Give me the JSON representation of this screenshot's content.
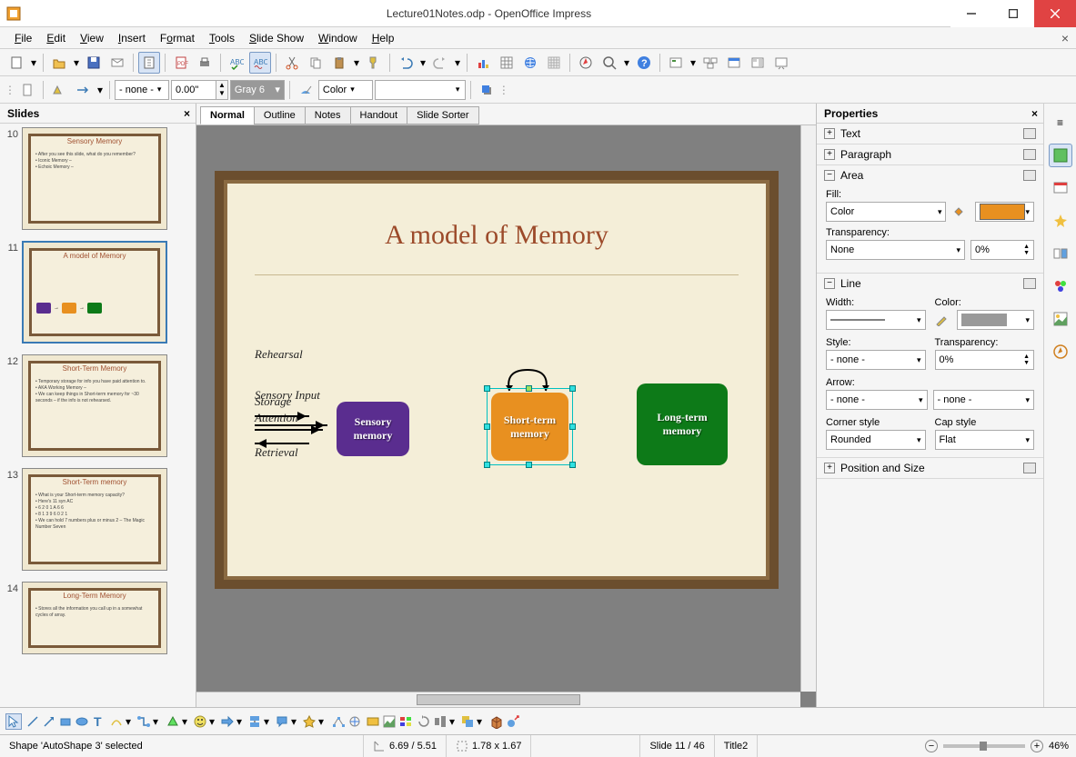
{
  "app": {
    "title": "Lecture01Notes.odp - OpenOffice Impress"
  },
  "menubar": [
    "File",
    "Edit",
    "View",
    "Insert",
    "Format",
    "Tools",
    "Slide Show",
    "Window",
    "Help"
  ],
  "toolbar2": {
    "style_combo": "- none -",
    "width_spin": "0.00\"",
    "color_combo": "Gray 6",
    "areastyle": "Color"
  },
  "viewtabs": [
    "Normal",
    "Outline",
    "Notes",
    "Handout",
    "Slide Sorter"
  ],
  "slides_panel": {
    "title": "Slides"
  },
  "thumbnails": [
    {
      "num": "10",
      "title": "Sensory Memory",
      "body": "• After you see this slide, what do you remember?\n• Iconic Memory –\n• Echoic Memory –"
    },
    {
      "num": "11",
      "title": "A model of Memory",
      "body": ""
    },
    {
      "num": "12",
      "title": "Short-Term Memory",
      "body": "• Temporary storage for info you have paid attention to.\n• AKA Working Memory –\n• We can keep things in Short-term memory for ~30 seconds – if the info is not rehearsed."
    },
    {
      "num": "13",
      "title": "Short-Term memory",
      "body": "• What is your Short-term memory capacity?\n• Here's 11 syn AC\n  • 6 2 0 1 A 6 6\n  • 8 1 3 9 6 0 2 1\n• We can hold 7 numbers plus or minus 2 – The Magic Number Seven"
    },
    {
      "num": "14",
      "title": "Long-Term Memory",
      "body": "• Stores all the information you call up in a somewhat cycles of array."
    }
  ],
  "slide_content": {
    "title": "A model of Memory",
    "sensory_input": "Sensory Input",
    "attention": "Attention",
    "rehearsal": "Rehearsal",
    "storage": "Storage",
    "retrieval": "Retrieval",
    "box1": "Sensory\nmemory",
    "box2": "Short-term\nmemory",
    "box3": "Long-term\nmemory"
  },
  "properties": {
    "title": "Properties",
    "sections": {
      "text": "Text",
      "paragraph": "Paragraph",
      "area": "Area",
      "line": "Line",
      "position": "Position and Size"
    },
    "area": {
      "fill_label": "Fill:",
      "fill_value": "Color",
      "transparency_label": "Transparency:",
      "transparency_type": "None",
      "transparency_value": "0%"
    },
    "line": {
      "width_label": "Width:",
      "color_label": "Color:",
      "style_label": "Style:",
      "style_value": "- none -",
      "transparency_label": "Transparency:",
      "transparency_value": "0%",
      "arrow_label": "Arrow:",
      "arrow_start": "- none -",
      "arrow_end": "- none -",
      "corner_label": "Corner style",
      "corner_value": "Rounded",
      "cap_label": "Cap style",
      "cap_value": "Flat"
    }
  },
  "statusbar": {
    "selection": "Shape 'AutoShape 3' selected",
    "pos": "6.69 / 5.51",
    "size": "1.78 x 1.67",
    "slide": "Slide 11 / 46",
    "template": "Title2",
    "zoom": "46%"
  }
}
